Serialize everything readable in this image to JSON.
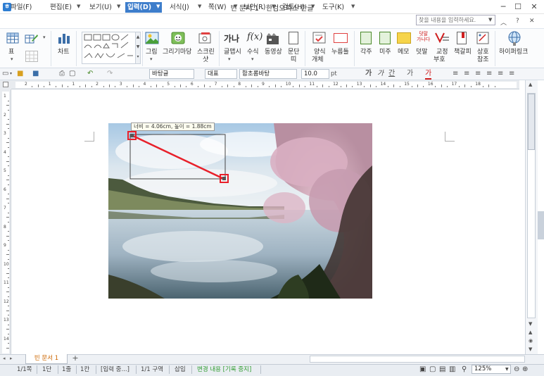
{
  "window": {
    "title": "빈 문서 1 - 한컴오피스 한글",
    "minimize": "─",
    "maximize": "☐",
    "close": "✕",
    "ribbon_collapse": "︿",
    "help": "?",
    "ribbon_close": "✕"
  },
  "menu": {
    "items": [
      {
        "label": "파일(F)"
      },
      {
        "label": "편집(E)"
      },
      {
        "label": "보기(U)"
      },
      {
        "label": "입력(D)"
      },
      {
        "label": "서식(J)"
      },
      {
        "label": "쪽(W)"
      },
      {
        "label": "보안(R)"
      },
      {
        "label": "검토(H)"
      },
      {
        "label": "도구(K)"
      }
    ],
    "search_placeholder": "찾을 내용을 입력하세요."
  },
  "ribbon": {
    "table": "표",
    "chart": "차트",
    "picture": "그림",
    "drawing_market": "그리기마당",
    "scanner": "스크린",
    "scanner2": "샷",
    "glyph_text": "가나",
    "glyph": "글맵시",
    "formula": "수식",
    "video": "동영상",
    "paragraph": "문단",
    "paragraph2": "띠",
    "form_object": "양식",
    "form_object2": "개체",
    "stamp": "누름틀",
    "footnote": "각주",
    "endnote": "미주",
    "memo": "메모",
    "overlap": "덧말",
    "overlap_icon": "덧말",
    "overlap_icon2": "가나다",
    "proofread": "교정",
    "proofread2": "부호",
    "bookmark": "책갈피",
    "cross_ref": "상호",
    "cross_ref2": "참조",
    "hyperlink": "하이퍼링크",
    "formula_icon": "f(x)"
  },
  "format_toolbar": {
    "style": "바탕글",
    "lang": "대표",
    "font": "함초롬바탕",
    "size": "10.0",
    "unit": "pt",
    "bold": "가",
    "italic": "가",
    "underline": "간",
    "strike": "가",
    "color": "가"
  },
  "ruler": {
    "h_numbers": [
      "2",
      "1",
      "1",
      "2",
      "3",
      "4",
      "5",
      "6",
      "7",
      "8",
      "9",
      "10",
      "11",
      "12",
      "13",
      "14",
      "15",
      "16",
      "17",
      "18"
    ],
    "v_numbers": [
      "1",
      "2",
      "3",
      "4",
      "5",
      "6",
      "7",
      "8",
      "9",
      "10",
      "11",
      "12",
      "13",
      "14"
    ]
  },
  "image": {
    "size_tooltip": "너비 = 4.06cm, 높이 = 1.88cm"
  },
  "tabs": {
    "doc_tab": "빈 문서 1",
    "add": "+"
  },
  "status": {
    "page": "1/1쪽",
    "column": "1단",
    "line": "1줄",
    "char": "1칸",
    "input": "[입력 중...]",
    "section": "1/1 구역",
    "insert": "삽입",
    "track": "변경 내용 [기록 중지]",
    "zoom": "125%"
  },
  "colors": {
    "accent": "#3d7dcb",
    "selection_red": "#e8202a",
    "track_green": "#2e9b2e"
  }
}
